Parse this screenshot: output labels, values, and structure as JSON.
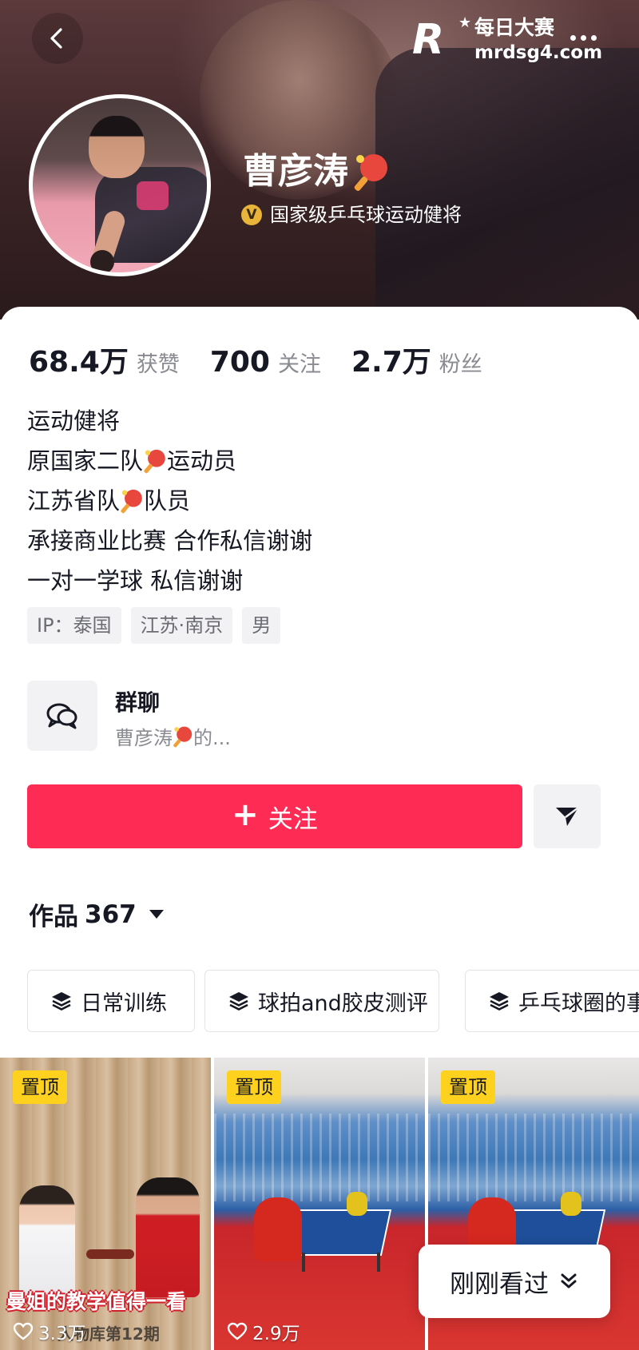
{
  "watermark": {
    "logo": "R",
    "name": "每日大赛",
    "url": "mrdsg4.com"
  },
  "profile": {
    "name": "曹彦涛",
    "verified_label": "国家级乒乓球运动健将",
    "verified_badge": "V"
  },
  "stats": [
    {
      "value": "68.4万",
      "label": "获赞"
    },
    {
      "value": "700",
      "label": "关注"
    },
    {
      "value": "2.7万",
      "label": "粉丝"
    }
  ],
  "bio": {
    "line1": "运动健将",
    "line2_a": "原国家二队",
    "line2_b": "运动员",
    "line3_a": "江苏省队",
    "line3_b": "队员",
    "line4": "承接商业比赛 合作私信谢谢",
    "line5": "一对一学球 私信谢谢"
  },
  "tags": [
    "IP：泰国",
    "江苏·南京",
    "男"
  ],
  "group_chat": {
    "title": "群聊",
    "subtitle_a": "曹彦涛",
    "subtitle_b": "的..."
  },
  "actions": {
    "follow_label": "关注",
    "follow_plus": "+"
  },
  "works": {
    "label": "作品",
    "count": "367"
  },
  "collections": [
    "日常训练",
    "球拍and胶皮测评",
    "乒乓球圈的事"
  ],
  "videos": [
    {
      "pinned": "置顶",
      "overlay": "曼姐的教学值得一看",
      "caption": "人物库第12期",
      "likes": "3.3万"
    },
    {
      "pinned": "置顶",
      "likes": "2.9万"
    },
    {
      "pinned": "置顶"
    }
  ],
  "recent_label": "刚刚看过",
  "colors": {
    "accent": "#fe2c55",
    "pinned": "#ffd11f",
    "verified": "#e9b43a"
  }
}
